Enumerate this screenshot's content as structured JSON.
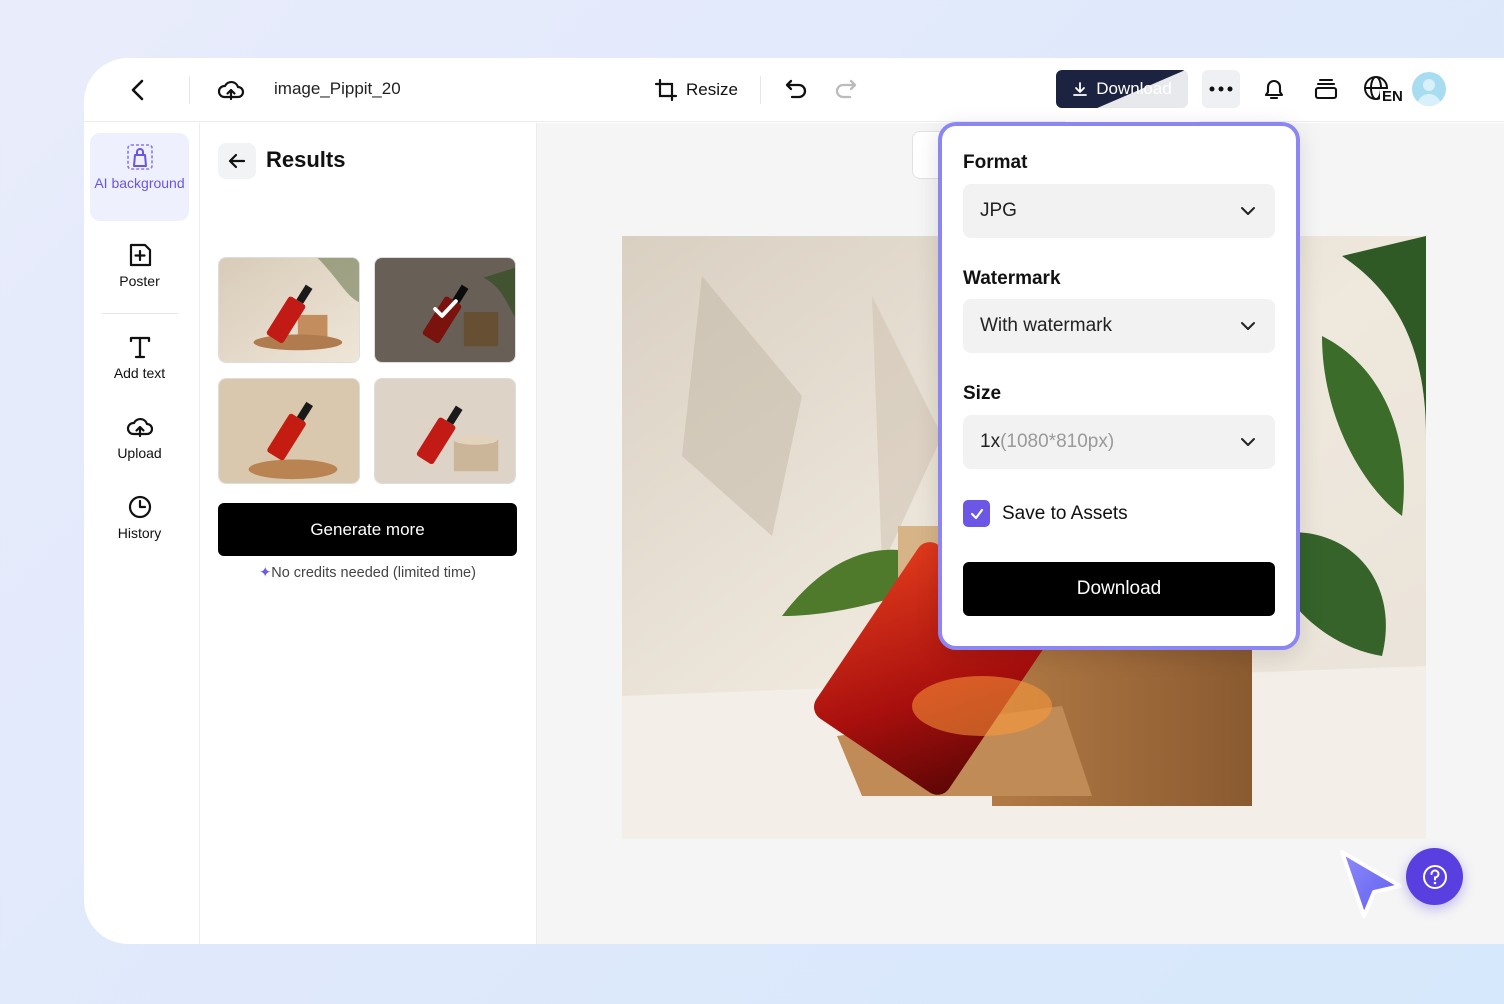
{
  "topbar": {
    "filename": "image_Pippit_20",
    "resize_label": "Resize",
    "download_label": "Download",
    "language": "EN"
  },
  "sidebar": {
    "items": [
      {
        "label": "AI background",
        "icon": "ai-background-icon"
      },
      {
        "label": "Poster",
        "icon": "poster-icon"
      },
      {
        "label": "Add text",
        "icon": "text-icon"
      },
      {
        "label": "Upload",
        "icon": "upload-icon"
      },
      {
        "label": "History",
        "icon": "history-icon"
      }
    ]
  },
  "results": {
    "title": "Results",
    "generate_label": "Generate more",
    "credits_note": "No credits needed (limited time)"
  },
  "download_panel": {
    "format_label": "Format",
    "format_value": "JPG",
    "watermark_label": "Watermark",
    "watermark_value": "With watermark",
    "size_label": "Size",
    "size_multiplier": "1x",
    "size_dims": "(1080*810px)",
    "save_assets_label": "Save to Assets",
    "save_assets_checked": true,
    "download_label": "Download"
  },
  "colors": {
    "accent": "#6c56e6",
    "help_button": "#5a3fe0",
    "download_topbar": "#1c2340",
    "popover_border": "#8b86f4"
  }
}
